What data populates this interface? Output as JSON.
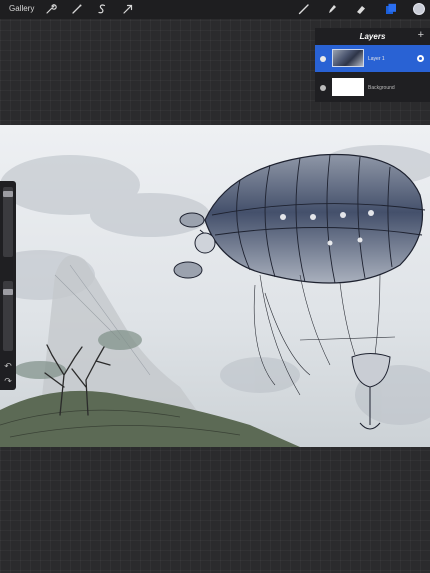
{
  "toolbar": {
    "gallery_label": "Gallery",
    "left_icons": [
      "wrench-icon",
      "adjustments-wand-icon",
      "selection-s-icon",
      "transform-arrow-icon"
    ],
    "right_icons": [
      "brush-icon",
      "smudge-icon",
      "eraser-icon",
      "layers-icon",
      "color-swatch-icon"
    ],
    "active_tool": "layers",
    "accent_color": "#2a6ef0",
    "current_color": "#c9ccd6"
  },
  "layers_panel": {
    "title": "Layers",
    "add_label": "+",
    "layers": [
      {
        "name": "Layer 1",
        "selected": true,
        "visible": true
      },
      {
        "name": "Background",
        "selected": false,
        "visible": true
      }
    ]
  },
  "sidebar": {
    "brush_size_level": 0.05,
    "opacity_level": 0.08,
    "undo_icon": "undo-icon",
    "redo_icon": "redo-icon"
  },
  "canvas": {
    "artwork": "airship-sketch",
    "colors": {
      "sky": "#e3e6ea",
      "airship": "#3b4560",
      "hills": "#5c6a55"
    }
  }
}
